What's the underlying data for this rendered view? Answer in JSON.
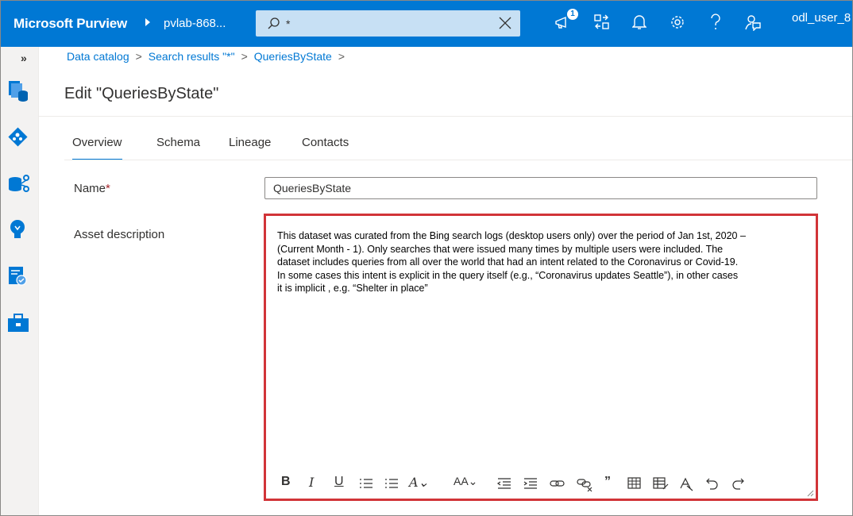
{
  "topbar": {
    "brand": "Microsoft Purview",
    "account": "pvlab-868...",
    "search_query": "*",
    "notification_count": "1",
    "user": "odl_user_8"
  },
  "breadcrumb": {
    "items": [
      "Data catalog",
      "Search results \"*\"",
      "QueriesByState"
    ]
  },
  "page": {
    "title": "Edit \"QueriesByState\""
  },
  "tabs": [
    "Overview",
    "Schema",
    "Lineage",
    "Contacts"
  ],
  "form": {
    "name_label": "Name",
    "name_required": "*",
    "name_value": "QueriesByState",
    "description_label": "Asset description",
    "description_lines": [
      "This dataset was curated from the Bing search logs (desktop users only) over the period of Jan 1st, 2020 –",
      "(Current Month - 1). Only searches that were issued many times by multiple users were included. The",
      "dataset includes queries from all over the world that had an intent related to the Coronavirus or Covid-19.",
      "In some cases this intent is explicit in the query itself (e.g., “Coronavirus updates Seattle”), in other cases",
      "it is implicit , e.g. “Shelter in place”"
    ]
  },
  "colors": {
    "topbar": "#0078d4",
    "accent": "#0078d4",
    "highlight_border": "#d13438"
  },
  "icons": {
    "rail": [
      "expand-icon",
      "data-catalog-icon",
      "data-map-icon",
      "data-estate-icon",
      "insights-icon",
      "policy-icon",
      "management-icon"
    ],
    "toolbar": [
      "bold",
      "italic",
      "underline",
      "bulleted-list",
      "numbered-list",
      "font-color",
      "font-size",
      "decrease-indent",
      "increase-indent",
      "link",
      "unlink",
      "quote",
      "insert-table",
      "format-table",
      "clear-format",
      "undo",
      "redo"
    ]
  }
}
